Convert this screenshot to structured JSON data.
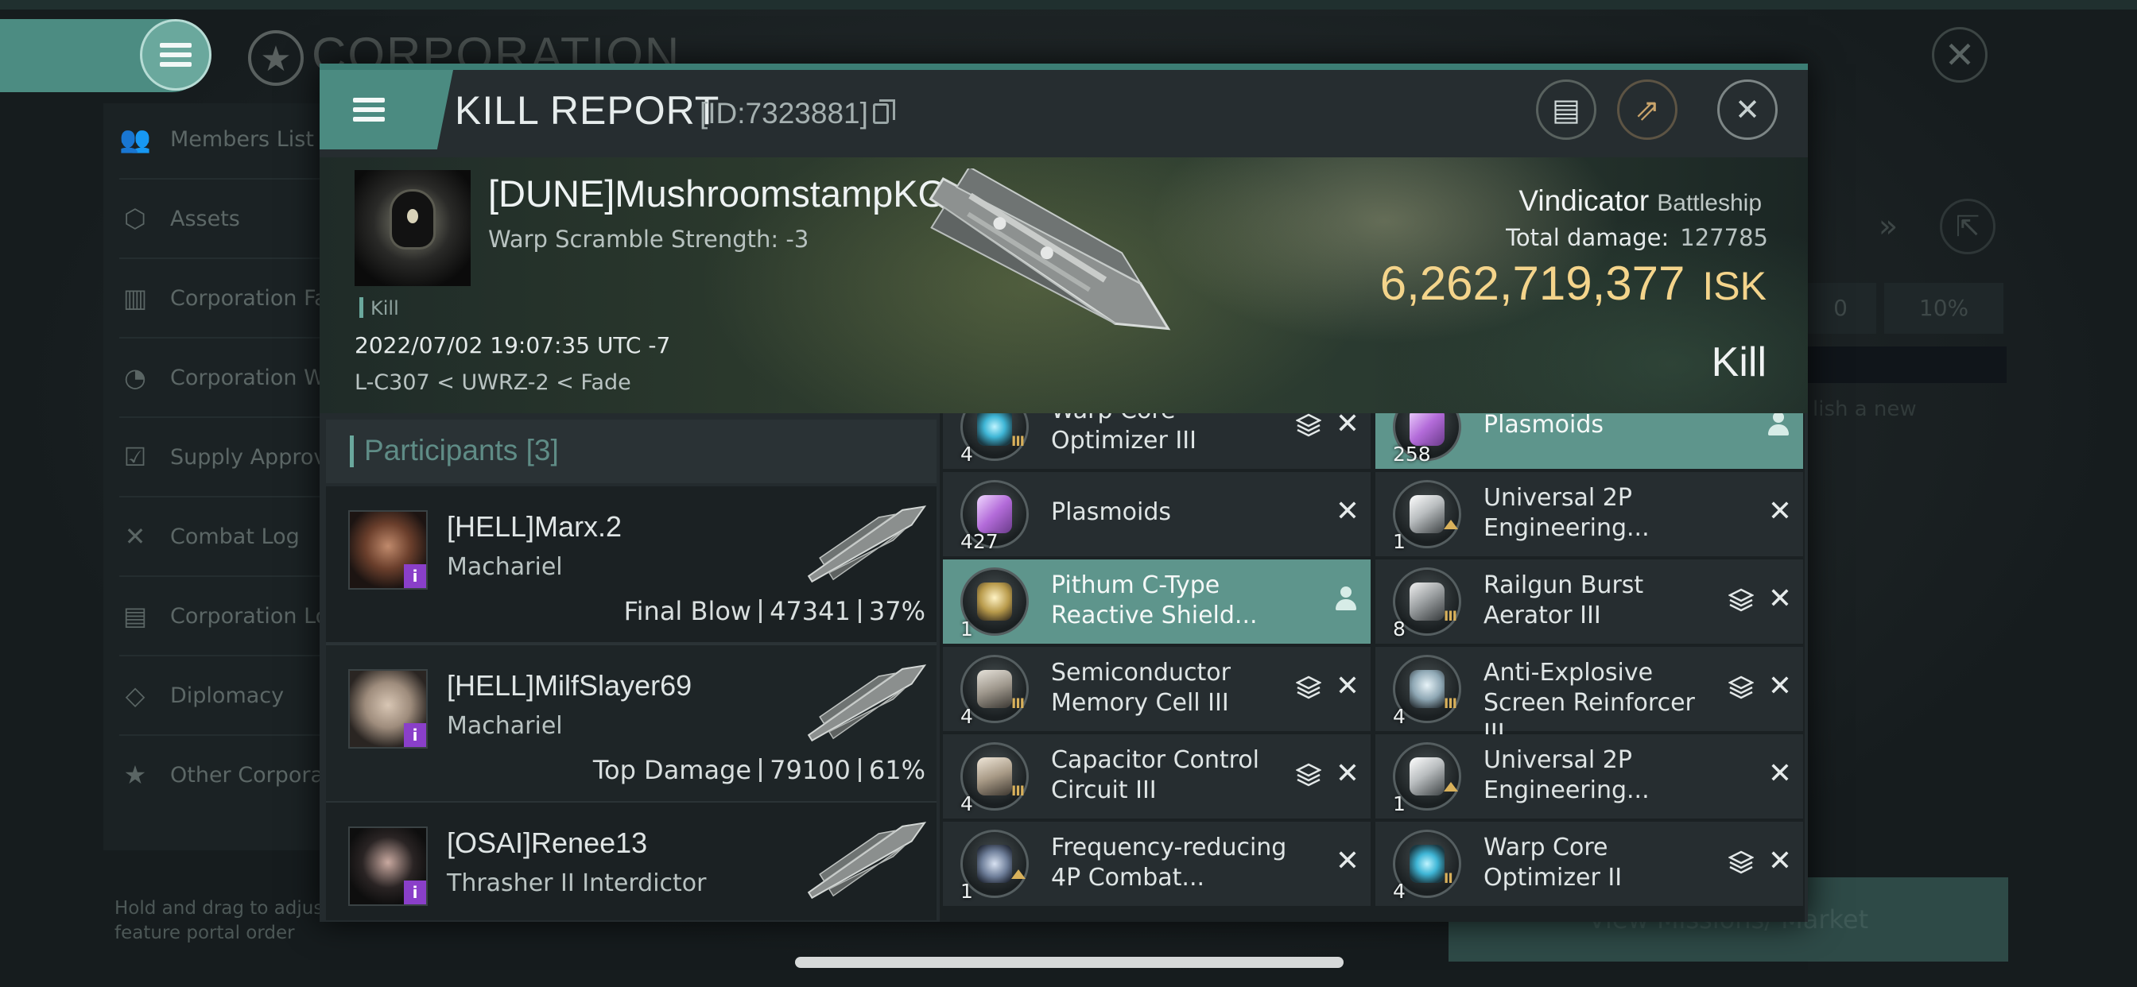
{
  "background": {
    "page_title": "CORPORATION",
    "sidebar": [
      {
        "label": "Members List",
        "icon": "members-icon"
      },
      {
        "label": "Assets",
        "icon": "assets-icon"
      },
      {
        "label": "Corporation Fa",
        "icon": "facilities-icon"
      },
      {
        "label": "Corporation Wa",
        "icon": "wallet-icon"
      },
      {
        "label": "Supply Approva",
        "icon": "supply-icon"
      },
      {
        "label": "Combat Log",
        "icon": "combat-icon"
      },
      {
        "label": "Corporation Lo",
        "icon": "log-icon"
      },
      {
        "label": "Diplomacy",
        "icon": "diplomacy-icon"
      },
      {
        "label": "Other Corporat",
        "icon": "other-corp-icon"
      }
    ],
    "drag_hint": "Hold and drag to adjust\nfeature portal order",
    "right_field_1": "0",
    "right_field_2": "10%",
    "right_publish_text": "lish a new",
    "view_button": "View Missions/ Market"
  },
  "report": {
    "title": "KILL REPORT",
    "id_text": "[ID:7323881]",
    "victim": {
      "name": "[DUNE]MushroomstampKO",
      "warp_scramble": "Warp Scramble Strength: -3",
      "result_tag": "Kill",
      "datetime": "2022/07/02 19:07:35 UTC -7",
      "location": "L-C307 < UWRZ-2 < Fade",
      "ship_name": "Vindicator",
      "ship_class": "Battleship",
      "total_damage_label": "Total damage:",
      "total_damage": "127785",
      "isk_value": "6,262,719,377",
      "isk_unit": "ISK",
      "outcome": "Kill"
    },
    "participants": {
      "label": "Participants",
      "count": "[3]",
      "rows": [
        {
          "name": "[HELL]Marx.2",
          "ship": "Machariel",
          "stat_label": "Final Blow",
          "damage": "47341",
          "percent": "37%"
        },
        {
          "name": "[HELL]MilfSlayer69",
          "ship": "Machariel",
          "stat_label": "Top Damage",
          "damage": "79100",
          "percent": "61%"
        },
        {
          "name": "[OSAI]Renee13",
          "ship": "Thrasher II Interdictor",
          "stat_label": "",
          "damage": "",
          "percent": ""
        }
      ]
    },
    "items_left": [
      {
        "name": "Warp Core Optimizer III",
        "qty": "4",
        "tier": "III",
        "icon": "warp-core-optimizer-icon",
        "stack": true,
        "highlight": false
      },
      {
        "name": "Plasmoids",
        "qty": "427",
        "tier": "",
        "icon": "plasmoid-icon",
        "stack": false,
        "highlight": false
      },
      {
        "name": "Pithum C-Type Reactive Shield...",
        "qty": "1",
        "tier": "",
        "icon": "shield-module-icon",
        "stack": false,
        "highlight": true
      },
      {
        "name": "Semiconductor Memory Cell III",
        "qty": "4",
        "tier": "III",
        "icon": "memory-cell-icon",
        "stack": true,
        "highlight": false
      },
      {
        "name": "Capacitor Control Circuit III",
        "qty": "4",
        "tier": "III",
        "icon": "capacitor-circuit-icon",
        "stack": true,
        "highlight": false
      },
      {
        "name": "Frequency-reducing 4P Combat...",
        "qty": "1",
        "tier": "up",
        "icon": "frequency-module-icon",
        "stack": false,
        "highlight": false
      }
    ],
    "items_right": [
      {
        "name": "Plasmoids",
        "qty": "258",
        "tier": "",
        "icon": "plasmoid-icon",
        "stack": false,
        "highlight": true
      },
      {
        "name": "Universal 2P Engineering...",
        "qty": "1",
        "tier": "up",
        "icon": "engineering-module-icon",
        "stack": false,
        "highlight": false
      },
      {
        "name": "Railgun Burst Aerator III",
        "qty": "8",
        "tier": "III",
        "icon": "railgun-aerator-icon",
        "stack": true,
        "highlight": false
      },
      {
        "name": "Anti-Explosive Screen Reinforcer III",
        "qty": "4",
        "tier": "III",
        "icon": "screen-reinforcer-icon",
        "stack": true,
        "highlight": false
      },
      {
        "name": "Universal 2P Engineering...",
        "qty": "1",
        "tier": "up",
        "icon": "engineering-module-icon",
        "stack": false,
        "highlight": false
      },
      {
        "name": "Warp Core Optimizer II",
        "qty": "4",
        "tier": "II",
        "icon": "warp-core-optimizer-icon",
        "stack": true,
        "highlight": false
      }
    ],
    "colors": {
      "accent": "#5e958c",
      "isk": "#f4d48b",
      "tier": "#d9b15b",
      "badge": "#8a3fc9"
    }
  }
}
